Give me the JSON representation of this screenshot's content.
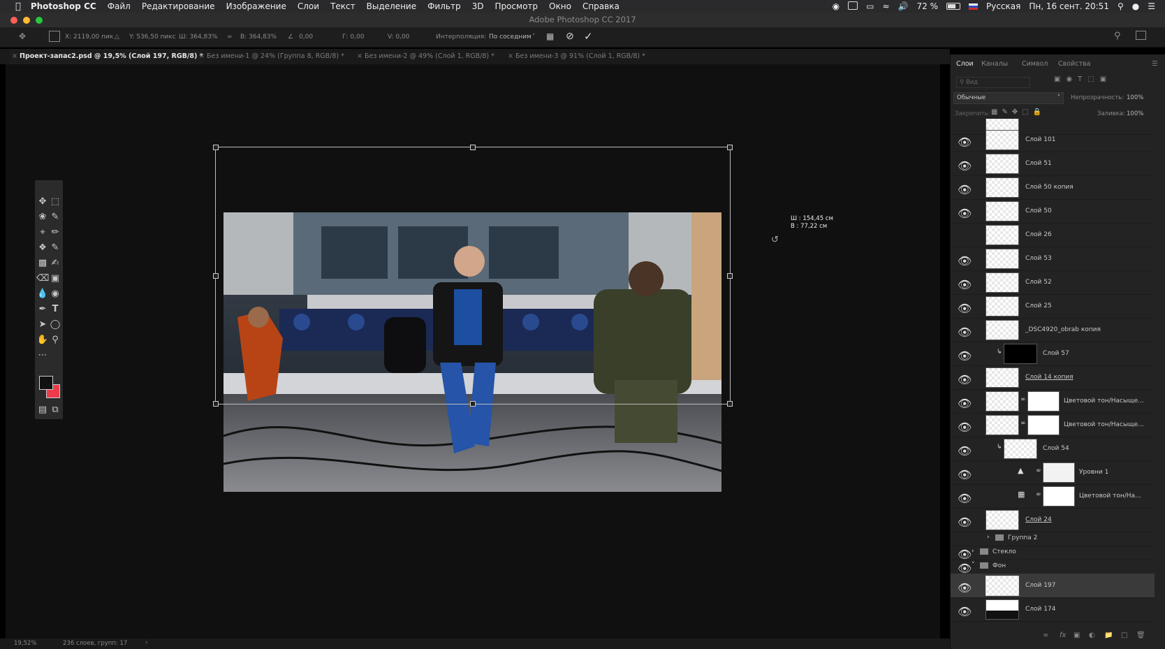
{
  "menubar": {
    "app": "Photoshop CC",
    "items": [
      "Файл",
      "Редактирование",
      "Изображение",
      "Слои",
      "Текст",
      "Выделение",
      "Фильтр",
      "3D",
      "Просмотр",
      "Окно",
      "Справка"
    ],
    "battery": "72 %",
    "language": "Русская",
    "datetime": "Пн, 16 сент.  20:51"
  },
  "window": {
    "title": "Adobe Photoshop CC 2017"
  },
  "options_bar": {
    "x": "X: 2119,00 пик",
    "y": "Y: 536,50 пикс",
    "w": "Ш: 364,83%",
    "h": "В: 364,83%",
    "angle": "0,00",
    "h_skew": "Г: 0,00",
    "v_skew": "V: 0,00",
    "interp_label": "Интерполяция:",
    "interp_value": "По соседним"
  },
  "tabs": [
    {
      "label": "Проект-запас2.psd @ 19,5% (Слой 197, RGB/8) *",
      "active": true
    },
    {
      "label": "Без имени-1 @ 24% (Группа 8, RGB/8) *",
      "active": false
    },
    {
      "label": "Без имени-2 @ 49% (Слой 1, RGB/8) *",
      "active": false
    },
    {
      "label": "Без имени-3 @ 91% (Слой 1, RGB/8) *",
      "active": false
    }
  ],
  "size_tooltip": {
    "w": "Ш : 154,45 см",
    "h": "В :   77,22 см"
  },
  "status": {
    "zoom": "19,52%",
    "info": "236 слоев, групп: 17"
  },
  "panel": {
    "tabs": [
      "Слои",
      "Каналы",
      "Символ",
      "Свойства"
    ],
    "search_placeholder": "Вид",
    "blend_mode": "Обычные",
    "opacity_label": "Непрозрачность:",
    "opacity": "100%",
    "lock_label": "Закрепить:",
    "fill_label": "Заливка:",
    "fill": "100%",
    "layers": [
      {
        "name": "Слой 101",
        "visible": true
      },
      {
        "name": "Слой 51",
        "visible": true
      },
      {
        "name": "Слой 50 копия",
        "visible": true
      },
      {
        "name": "Слой 50",
        "visible": true
      },
      {
        "name": "Слой 26",
        "visible": false
      },
      {
        "name": "Слой 53",
        "visible": true
      },
      {
        "name": "Слой 52",
        "visible": true
      },
      {
        "name": "Слой 25",
        "visible": true
      },
      {
        "name": "_DSC4920_obrab копия",
        "visible": true
      },
      {
        "name": "Слой 57",
        "visible": true
      },
      {
        "name": "Слой 14 копия",
        "visible": true
      },
      {
        "name": "Цветовой тон/Насыще...",
        "visible": true
      },
      {
        "name": "Цветовой тон/Насыще...",
        "visible": true
      },
      {
        "name": "Слой 54",
        "visible": true
      },
      {
        "name": "Уровни 1",
        "visible": true
      },
      {
        "name": "Цветовой тон/На...",
        "visible": true
      },
      {
        "name": "Слой 24",
        "visible": true
      }
    ],
    "groups": [
      {
        "name": "Группа 2"
      },
      {
        "name": "Стекло"
      },
      {
        "name": "Фон"
      }
    ],
    "bottom_layers": [
      {
        "name": "Слой 197",
        "selected": true
      },
      {
        "name": "Слой 174",
        "selected": false
      }
    ]
  }
}
